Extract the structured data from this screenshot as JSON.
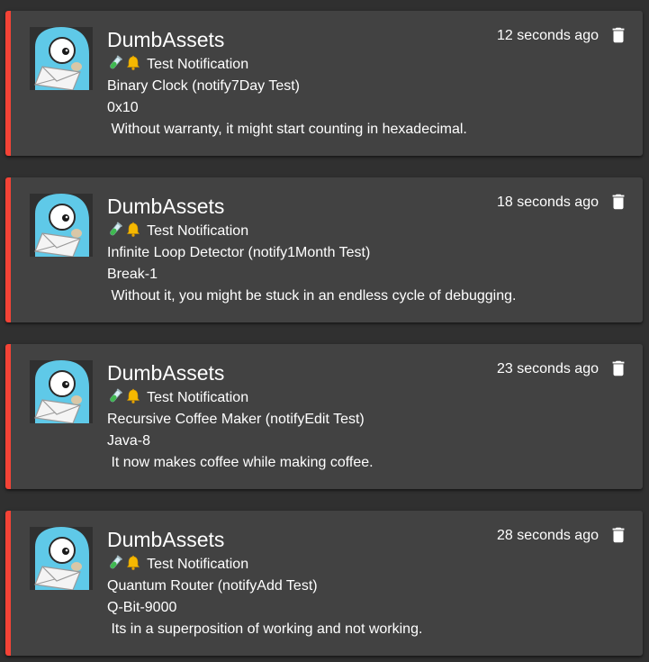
{
  "colors": {
    "background": "#303030",
    "card": "#424242",
    "accent_bar": "#f44336",
    "text": "#ffffff",
    "avatar_blue": "#5fc9e8"
  },
  "icons": {
    "avatar": "gopher-mail-icon",
    "test_tube": "test-tube-icon",
    "bell": "bell-icon",
    "delete": "trash-icon"
  },
  "notifications": [
    {
      "app": "DumbAssets",
      "time": "12 seconds ago",
      "type": "Test Notification",
      "item": "Binary Clock (notify7Day Test)",
      "code": "0x10",
      "message": " Without warranty, it might start counting in hexadecimal."
    },
    {
      "app": "DumbAssets",
      "time": "18 seconds ago",
      "type": "Test Notification",
      "item": "Infinite Loop Detector (notify1Month Test)",
      "code": "Break-1",
      "message": " Without it, you might be stuck in an endless cycle of debugging."
    },
    {
      "app": "DumbAssets",
      "time": "23 seconds ago",
      "type": "Test Notification",
      "item": "Recursive Coffee Maker (notifyEdit Test)",
      "code": "Java-8",
      "message": " It now makes coffee while making coffee."
    },
    {
      "app": "DumbAssets",
      "time": "28 seconds ago",
      "type": "Test Notification",
      "item": "Quantum Router (notifyAdd Test)",
      "code": "Q-Bit-9000",
      "message": " Its in a superposition of working and not working."
    }
  ]
}
